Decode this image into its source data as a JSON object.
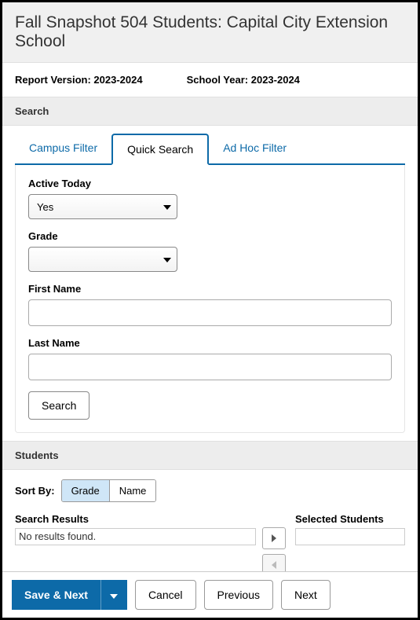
{
  "header": {
    "title": "Fall Snapshot 504 Students: Capital City Extension School"
  },
  "meta": {
    "report_version_label": "Report Version:",
    "report_version_value": "2023-2024",
    "school_year_label": "School Year:",
    "school_year_value": "2023-2024"
  },
  "search": {
    "section_label": "Search",
    "tabs": {
      "campus_filter": "Campus Filter",
      "quick_search": "Quick Search",
      "ad_hoc_filter": "Ad Hoc Filter"
    },
    "form": {
      "active_today_label": "Active Today",
      "active_today_value": "Yes",
      "grade_label": "Grade",
      "grade_value": "",
      "first_name_label": "First Name",
      "first_name_value": "",
      "last_name_label": "Last Name",
      "last_name_value": "",
      "search_button": "Search"
    }
  },
  "students": {
    "section_label": "Students",
    "sort_by_label": "Sort By:",
    "sort_grade": "Grade",
    "sort_name": "Name",
    "search_results_label": "Search Results",
    "no_results_text": "No results found.",
    "selected_students_label": "Selected Students"
  },
  "footer": {
    "save_next": "Save & Next",
    "cancel": "Cancel",
    "previous": "Previous",
    "next": "Next"
  }
}
